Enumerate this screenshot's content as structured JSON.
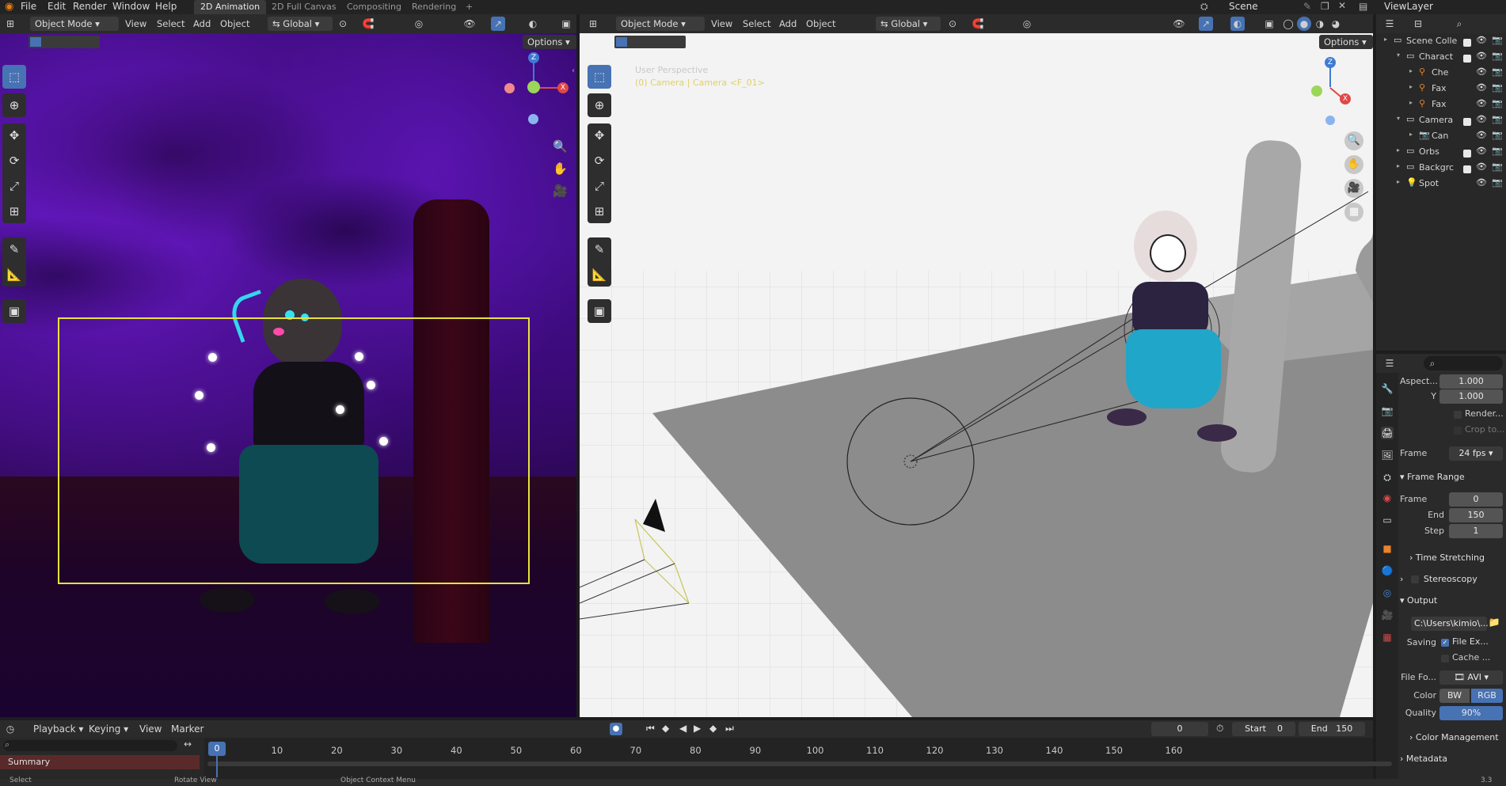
{
  "menu": [
    "File",
    "Edit",
    "Render",
    "Window",
    "Help"
  ],
  "workspaces": [
    "2D Animation",
    "2D Full Canvas",
    "Compositing",
    "Rendering"
  ],
  "add_tab": "+",
  "scene": {
    "label": "Scene"
  },
  "viewlayer": {
    "label": "ViewLayer"
  },
  "left_view": {
    "mode": "Object Mode",
    "menus": [
      "View",
      "Select",
      "Add",
      "Object"
    ],
    "orientation": "Global",
    "options": "Options",
    "gizmo": {
      "z": "Z",
      "x": "X"
    }
  },
  "right_view": {
    "mode": "Object Mode",
    "menus": [
      "View",
      "Select",
      "Add",
      "Object"
    ],
    "orientation": "Global",
    "options": "Options",
    "overlay_line1": "User Perspective",
    "overlay_line2": "(0) Camera | Camera <F_01>",
    "gizmo": {
      "z": "Z",
      "x": "X"
    }
  },
  "outliner": {
    "rows": [
      {
        "label": "Scene Colle",
        "indent": 0,
        "kind": "collection"
      },
      {
        "label": "Charact",
        "indent": 1,
        "kind": "collection"
      },
      {
        "label": "Che",
        "indent": 2,
        "kind": "armature"
      },
      {
        "label": "Fax",
        "indent": 2,
        "kind": "armature"
      },
      {
        "label": "Fax",
        "indent": 2,
        "kind": "armature"
      },
      {
        "label": "Camera",
        "indent": 1,
        "kind": "collection"
      },
      {
        "label": "Can",
        "indent": 2,
        "kind": "camera"
      },
      {
        "label": "Orbs",
        "indent": 1,
        "kind": "collection"
      },
      {
        "label": "Backgrc",
        "indent": 1,
        "kind": "collection"
      },
      {
        "label": "Spot",
        "indent": 1,
        "kind": "light"
      }
    ]
  },
  "properties": {
    "aspect_label": "Aspect...",
    "aspect_x": "1.000",
    "aspect_y_label": "Y",
    "aspect_y": "1.000",
    "render_region": "Render...",
    "crop": "Crop to...",
    "frame_rate_label": "Frame",
    "frame_rate": "24 fps",
    "frame_range_title": "Frame Range",
    "frame_start_label": "Frame",
    "frame_start": "0",
    "end_label": "End",
    "end": "150",
    "step_label": "Step",
    "step": "1",
    "time_stretching": "Time Stretching",
    "stereoscopy": "Stereoscopy",
    "output_title": "Output",
    "output_path": "C:\\Users\\kimio\\...",
    "saving_label": "Saving",
    "file_ext": "File Ex...",
    "cache": "Cache ...",
    "file_format_label": "File Fo...",
    "file_format": "AVI",
    "color_label": "Color",
    "bw": "BW",
    "rgb": "RGB",
    "quality_label": "Quality",
    "quality": "90%",
    "color_management": "Color Management",
    "metadata": "Metadata"
  },
  "timeline": {
    "menus": [
      "Playback",
      "Keying",
      "View",
      "Marker"
    ],
    "current_frame": "0",
    "start_label": "Start",
    "start": "0",
    "end_label": "End",
    "end": "150",
    "ticks": [
      "0",
      "10",
      "20",
      "30",
      "40",
      "50",
      "60",
      "70",
      "80",
      "90",
      "100",
      "110",
      "120",
      "130",
      "140",
      "150",
      "160"
    ],
    "summary": "Summary"
  },
  "status": [
    "Select",
    "Rotate View",
    "Object Context Menu",
    "3.3"
  ],
  "colors": {
    "accent": "#4772b3",
    "camera_frame": "#e8e23a",
    "summary": "#5a2a2a"
  }
}
